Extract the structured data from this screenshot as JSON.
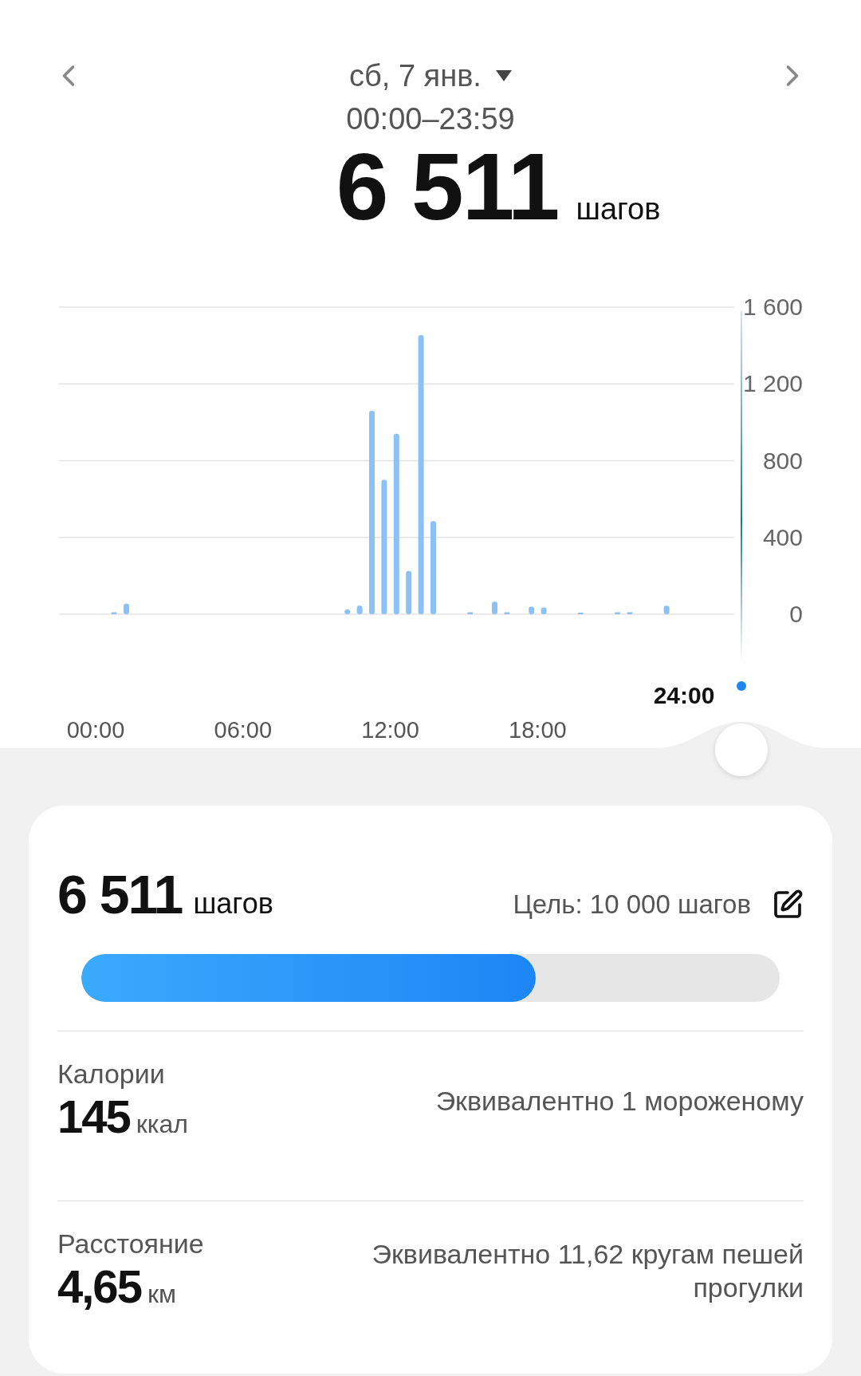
{
  "header": {
    "date": "сб, 7 янв.",
    "time_range": "00:00–23:59",
    "total": "6 511",
    "total_unit": "шагов"
  },
  "chart": {
    "cursor_label": "24:00",
    "chart_data": {
      "type": "bar",
      "grid": true,
      "xlim": [
        -1.5,
        26
      ],
      "x": [
        0.75,
        1.25,
        10.25,
        10.75,
        11.25,
        11.75,
        12.25,
        12.75,
        13.25,
        13.75,
        15.25,
        16.25,
        16.75,
        17.75,
        18.25,
        19.75,
        21.25,
        21.75,
        23.25
      ],
      "series": [
        {
          "color": "#8cc1f5",
          "values": [
            10,
            55,
            25,
            45,
            1060,
            700,
            940,
            225,
            1455,
            485,
            10,
            65,
            10,
            40,
            35,
            8,
            10,
            10,
            45
          ]
        }
      ],
      "ylim": [
        0,
        1600
      ],
      "yticks": [
        {
          "value": 0,
          "label": "0"
        },
        {
          "value": 400,
          "label": "400"
        },
        {
          "value": 800,
          "label": "800"
        },
        {
          "value": 1200,
          "label": "1 200"
        },
        {
          "value": 1600,
          "label": "1 600"
        }
      ],
      "xticks": [
        {
          "value": 0,
          "label": "00:00"
        },
        {
          "value": 6,
          "label": "06:00"
        },
        {
          "value": 12,
          "label": "12:00"
        },
        {
          "value": 18,
          "label": "18:00"
        }
      ]
    }
  },
  "card": {
    "steps": "6 511",
    "steps_unit": "шагов",
    "goal": "Цель: 10 000 шагов",
    "progress": {
      "level": 0.6511
    },
    "stats": [
      {
        "label": "Калории",
        "value": "145",
        "unit": "ккал",
        "note": "Эквивалентно 1 мороженому"
      },
      {
        "label": "Расстояние",
        "value": "4,65",
        "unit": "км",
        "note": "Эквивалентно 11,62 кругам пешей прогулки"
      }
    ]
  }
}
